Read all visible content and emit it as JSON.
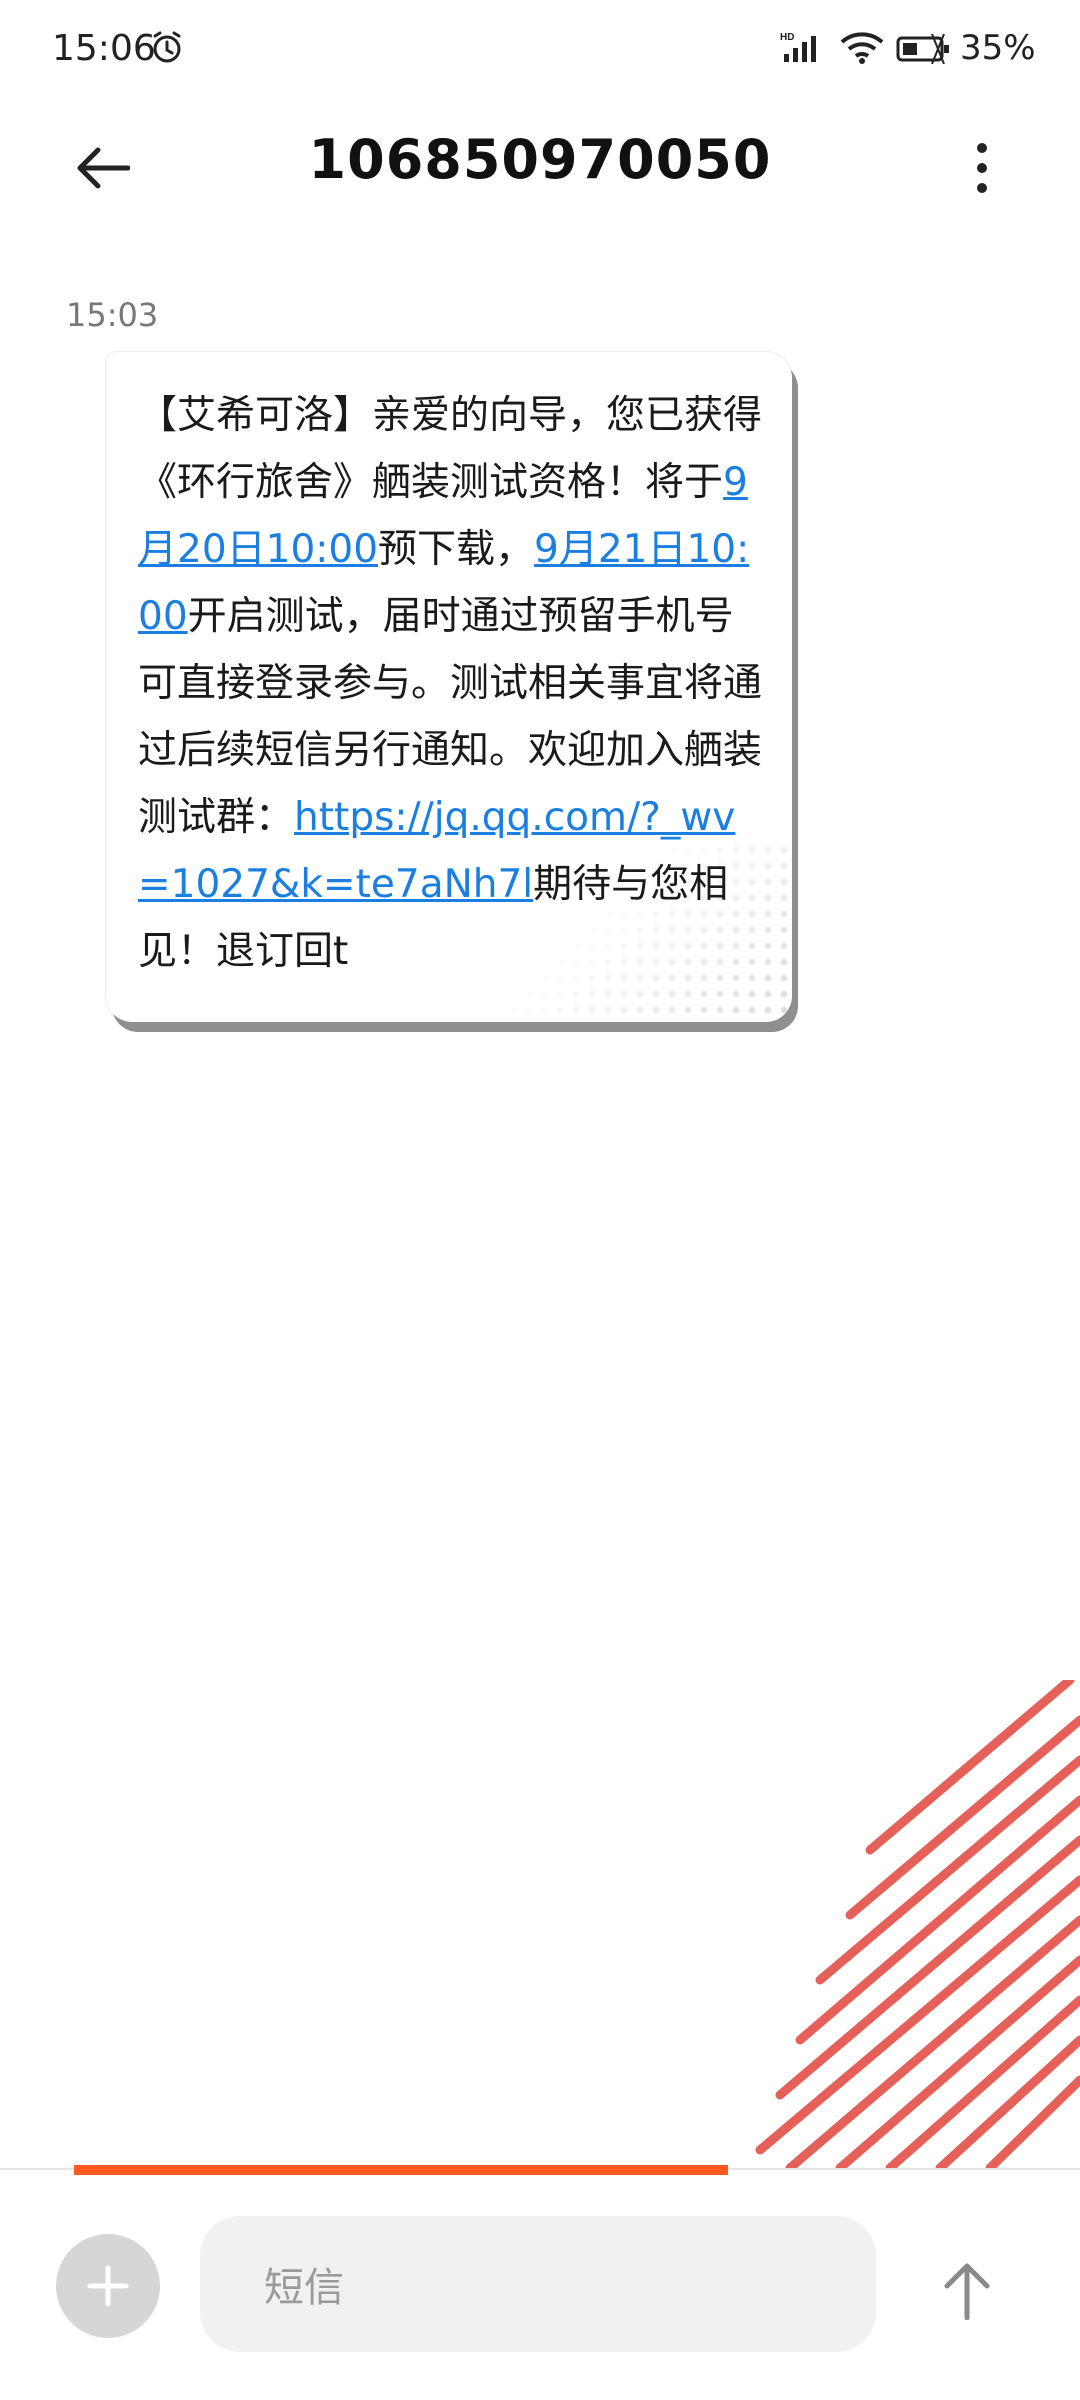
{
  "status_bar": {
    "time": "15:06",
    "battery": "35%",
    "icons": [
      "alarm-icon",
      "hd-signal-icon",
      "wifi-icon",
      "battery-icon"
    ]
  },
  "header": {
    "title": "106850970050",
    "back_icon": "back-arrow-icon",
    "menu_icon": "more-vertical-icon"
  },
  "conversation": {
    "messages": [
      {
        "time": "15:03",
        "parts": [
          {
            "text": "【艾希可洛】亲爱的向导，您已获得《环行旅舍》舾装测试资格！将于"
          },
          {
            "text": "9月20日10:00",
            "link": true
          },
          {
            "text": "预下载，"
          },
          {
            "text": "9月21日10:00",
            "link": true
          },
          {
            "text": "开启测试，届时通过预留手机号可直接登录参与。测试相关事宜将通过后续短信另行通知。欢迎加入舾装测试群："
          },
          {
            "text": "https://jq.qq.com/?_wv=1027&k=te7aNh7l",
            "link": true
          },
          {
            "text": "期待与您相见！退订回t"
          }
        ]
      }
    ]
  },
  "composer": {
    "placeholder": "短信",
    "attach_icon": "plus-icon",
    "send_icon": "send-arrow-icon"
  },
  "colors": {
    "link": "#1a7fe0",
    "progress": "#ff5a1f",
    "stripes": "#e0453d"
  }
}
